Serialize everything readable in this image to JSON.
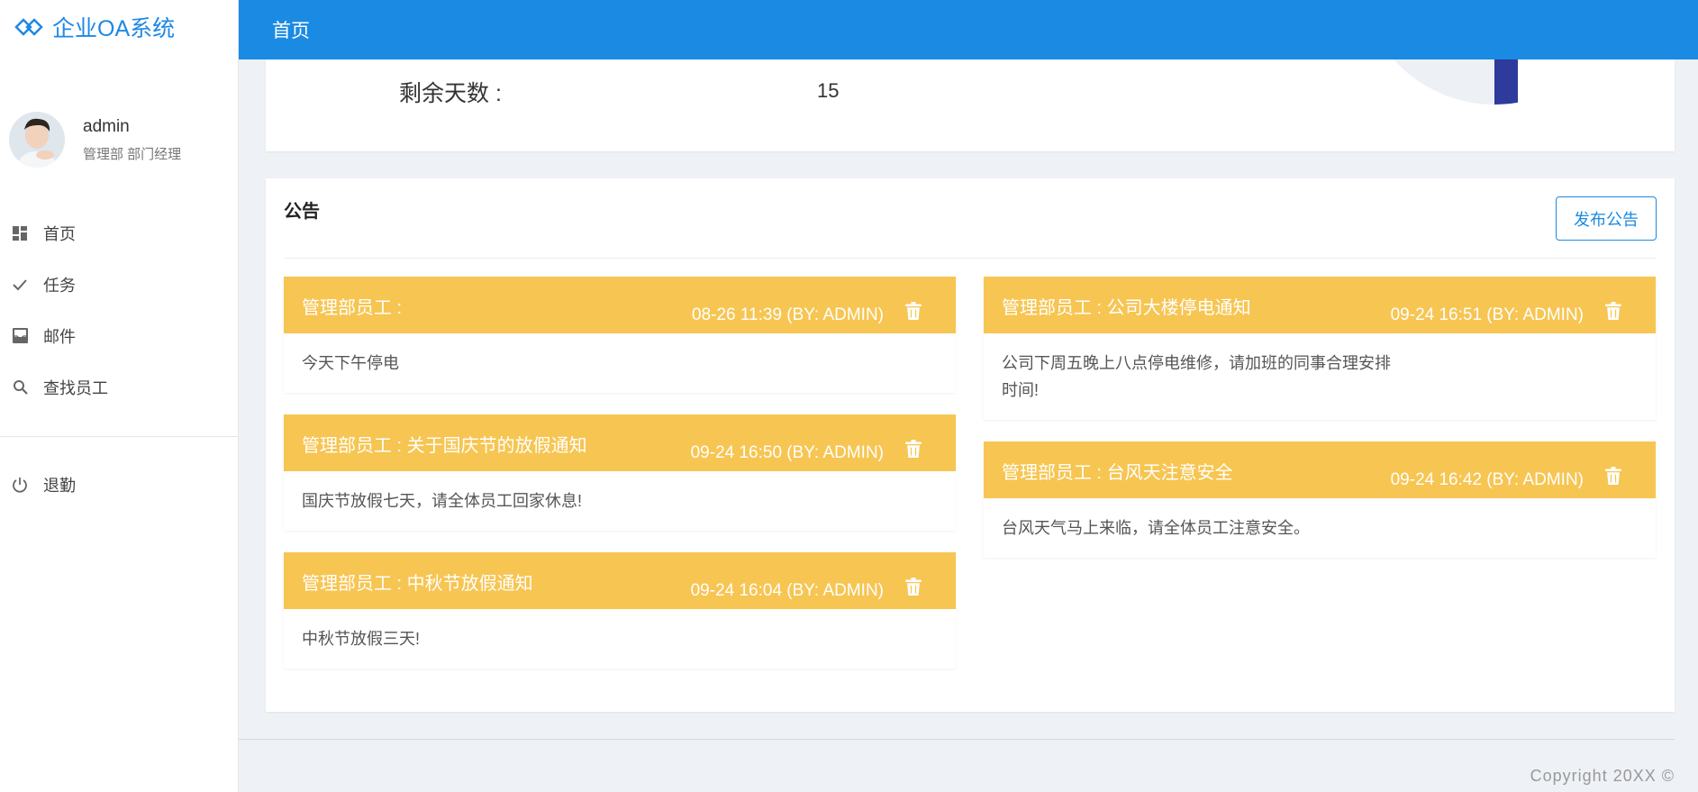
{
  "brand": {
    "title": "企业OA系统",
    "accent": "#1e88e5"
  },
  "user": {
    "name": "admin",
    "role": "管理部 部门经理"
  },
  "menu": [
    {
      "label": "首页",
      "icon": "dashboard-icon"
    },
    {
      "label": "任务",
      "icon": "check-icon"
    },
    {
      "label": "邮件",
      "icon": "mail-icon"
    },
    {
      "label": "查找员工",
      "icon": "search-icon"
    }
  ],
  "logout": {
    "label": "退勤",
    "icon": "power-icon"
  },
  "header": {
    "title": "首页",
    "color": "#1b8ae3"
  },
  "summary": {
    "remaining_label": "剩余天数 :",
    "remaining_value": "15"
  },
  "notices_card": {
    "title": "公告",
    "publish_label": "发布公告"
  },
  "notices_left": [
    {
      "title": "管理部员工 :",
      "meta": "08-26 11:39 (BY: ADMIN)",
      "body": "今天下午停电"
    },
    {
      "title": "管理部员工 : 关于国庆节的放假通知",
      "meta": "09-24 16:50 (BY: ADMIN)",
      "body": "国庆节放假七天，请全体员工回家休息!"
    },
    {
      "title": "管理部员工 : 中秋节放假通知",
      "meta": "09-24 16:04 (BY: ADMIN)",
      "body": "中秋节放假三天!"
    }
  ],
  "notices_right": [
    {
      "title": "管理部员工 : 公司大楼停电通知",
      "meta": "09-24 16:51 (BY: ADMIN)",
      "body": "公司下周五晚上八点停电维修，请加班的同事合理安排时间!"
    },
    {
      "title": "管理部员工 : 台风天注意安全",
      "meta": "09-24 16:42 (BY: ADMIN)",
      "body": "台风天气马上来临，请全体员工注意安全。"
    }
  ],
  "notice_color": "#f7c552",
  "footer": {
    "copyright": "Copyright 20XX ©"
  }
}
